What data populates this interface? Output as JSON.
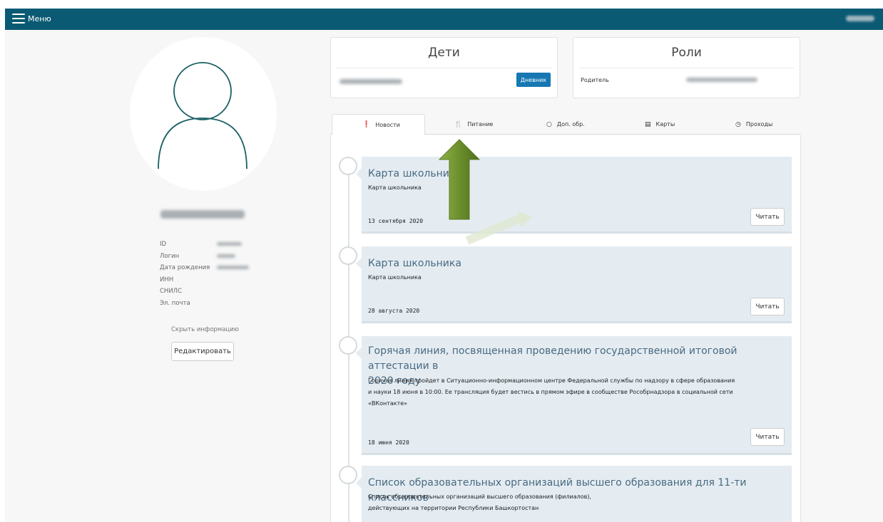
{
  "header": {
    "menu_label": "Меню"
  },
  "profile": {
    "fields": [
      {
        "label": "ID"
      },
      {
        "label": "Логин"
      },
      {
        "label": "Дата рождения"
      },
      {
        "label": "ИНН"
      },
      {
        "label": "СНИЛС"
      },
      {
        "label": "Эл. почта"
      }
    ],
    "hide_info": "Скрыть информацию",
    "edit_button": "Редактировать"
  },
  "children_card": {
    "title": "Дети",
    "diary_button": "Дневник"
  },
  "roles_card": {
    "title": "Роли",
    "role_label": "Родитель"
  },
  "tabs": [
    {
      "label": "Новости",
      "icon": "info-circle-icon"
    },
    {
      "label": "Питание",
      "icon": "fork-knife-icon"
    },
    {
      "label": "Доп. обр.",
      "icon": "circle-icon"
    },
    {
      "label": "Карты",
      "icon": "credit-card-icon"
    },
    {
      "label": "Проходы",
      "icon": "clock-icon"
    }
  ],
  "news": [
    {
      "title": "Карта школьника",
      "body": "Карта школьника",
      "date": "13 сентября 2020",
      "read": "Читать"
    },
    {
      "title": "Карта школьника",
      "body": "Карта школьника",
      "date": "28 августа 2020",
      "read": "Читать"
    },
    {
      "title_line1": "Горячая линия, посвященная проведению государственной итоговой аттестации в",
      "title_line2": "2020 году",
      "body_line1": "Горячая линия пройдет в Ситуационно-информационном центре Федеральной службы по надзору в сфере образования",
      "body_line2": "и науки 18 июня в 10:00. Ее трансляция будет вестись в прямом эфире в сообществе Рособрнадзора в социальной сети",
      "body_line3": "«ВКонтакте»",
      "date": "18 июня 2020",
      "read": "Читать"
    },
    {
      "title": "Список образовательных организаций высшего образования для 11-ти классников",
      "body_line1": "Список образовательных организаций высшего образования (филиалов),",
      "body_line2": "действующих на территории Республики Башкортостан"
    }
  ],
  "colors": {
    "topbar": "#0a5a73",
    "accent_button": "#1677b3",
    "news_bg": "#e4ecf2",
    "arrow": "#7a9a3a"
  }
}
